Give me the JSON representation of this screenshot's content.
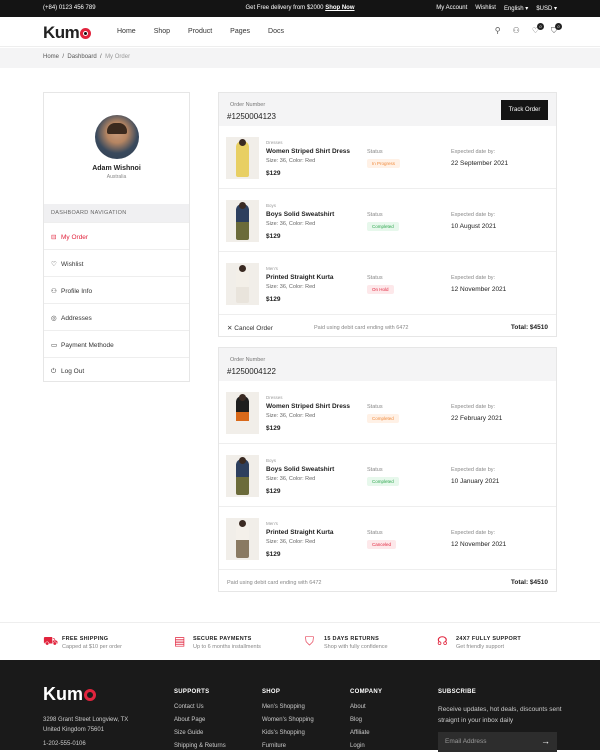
{
  "topbar": {
    "phone": "(+84) 0123 456 789",
    "promo": "Get Free delivery from $2000",
    "promo_link": "Shop Now",
    "account": "My Account",
    "wishlist": "Wishlist",
    "language": "English ▾",
    "currency": "$USD ▾"
  },
  "brand": {
    "logo_prefix": "Kum"
  },
  "nav": [
    "Home",
    "Shop",
    "Product",
    "Pages",
    "Docs"
  ],
  "header_icons": {
    "cart_count": "0",
    "wishlist_count": "0"
  },
  "breadcrumb": [
    "Home",
    "Dashboard",
    "My Order"
  ],
  "profile": {
    "name": "Adam Wishnoi",
    "location": "Australia"
  },
  "sidebar": {
    "heading": "DASHBOARD NAVIGATION",
    "items": [
      {
        "icon": "bag-icon",
        "label": "My Order"
      },
      {
        "icon": "heart-icon",
        "label": "Wishlist"
      },
      {
        "icon": "user-icon",
        "label": "Profile Info"
      },
      {
        "icon": "location-icon",
        "label": "Addresses"
      },
      {
        "icon": "card-icon",
        "label": "Payment Methode"
      },
      {
        "icon": "power-icon",
        "label": "Log Out"
      }
    ]
  },
  "orders": [
    {
      "label": "Order Number",
      "number": "#1250004123",
      "track_label": "Track Order",
      "items": [
        {
          "category": "Dresses",
          "name": "Women Striped Shirt Dress",
          "attrs": "Size: 36, Color: Red",
          "price": "$129",
          "status_label": "Status",
          "status": "In Progress",
          "date_label": "Expected date by:",
          "date": "22 September 2021"
        },
        {
          "category": "Boys",
          "name": "Boys Solid Sweatshirt",
          "attrs": "Size: 36, Color: Red",
          "price": "$129",
          "status_label": "Status",
          "status": "Completed",
          "date_label": "Expected date by:",
          "date": "10 August 2021"
        },
        {
          "category": "Men's",
          "name": "Printed Straight Kurta",
          "attrs": "Size: 36, Color: Red",
          "price": "$129",
          "status_label": "Status",
          "status": "On Hold",
          "date_label": "Expected date by:",
          "date": "12 November 2021"
        }
      ],
      "cancel_label": "Cancel Order",
      "paid_note": "Paid using debit card ending with 6472",
      "total": "Total: $4510"
    },
    {
      "label": "Order Number",
      "number": "#1250004122",
      "items": [
        {
          "category": "Dresses",
          "name": "Women Striped Shirt Dress",
          "attrs": "Size: 36, Color: Red",
          "price": "$129",
          "status_label": "Status",
          "status": "Completed",
          "date_label": "Expected date by:",
          "date": "22 February 2021"
        },
        {
          "category": "Boys",
          "name": "Boys Solid Sweatshirt",
          "attrs": "Size: 36, Color: Red",
          "price": "$129",
          "status_label": "Status",
          "status": "Completed",
          "date_label": "Expected date by:",
          "date": "10 January 2021"
        },
        {
          "category": "Men's",
          "name": "Printed Straight Kurta",
          "attrs": "Size: 36, Color: Red",
          "price": "$129",
          "status_label": "Status",
          "status": "Canceled",
          "date_label": "Expected date by:",
          "date": "12 November 2021"
        }
      ],
      "paid_note": "Paid using debit card ending with 6472",
      "total": "Total: $4510"
    }
  ],
  "features": [
    {
      "icon": "basket-icon",
      "title": "FREE SHIPPING",
      "sub": "Capped at $10 per order"
    },
    {
      "icon": "card-icon",
      "title": "SECURE PAYMENTS",
      "sub": "Up to 6 months installments"
    },
    {
      "icon": "shield-icon",
      "title": "15 DAYS RETURNS",
      "sub": "Shop with fully confidence"
    },
    {
      "icon": "headset-icon",
      "title": "24X7 FULLY SUPPORT",
      "sub": "Get friendly support"
    }
  ],
  "footer": {
    "address_line1": "3298 Grant Street Longview, TX",
    "address_line2": "United Kingdom 75601",
    "phone": "1-202-555-0106",
    "columns": [
      {
        "heading": "SUPPORTS",
        "links": [
          "Contact Us",
          "About Page",
          "Size Guide",
          "Shipping & Returns"
        ]
      },
      {
        "heading": "SHOP",
        "links": [
          "Men's Shopping",
          "Women's Shopping",
          "Kids's Shopping",
          "Furniture"
        ]
      },
      {
        "heading": "COMPANY",
        "links": [
          "About",
          "Blog",
          "Affiliate",
          "Login"
        ]
      }
    ],
    "subscribe_heading": "SUBSCRIBE",
    "subscribe_text": "Receive updates, hot deals, discounts sent straignt in your inbox daily",
    "email_placeholder": "Email Address"
  },
  "colors": {
    "accent": "#e1243d",
    "dark": "#141414",
    "progress_bg": "#fff1e6",
    "progress_fg": "#f08a3c",
    "completed_bg": "#e7f8ec",
    "completed_fg": "#2fa74f",
    "hold_bg": "#fde8ea",
    "hold_fg": "#e1243d"
  }
}
